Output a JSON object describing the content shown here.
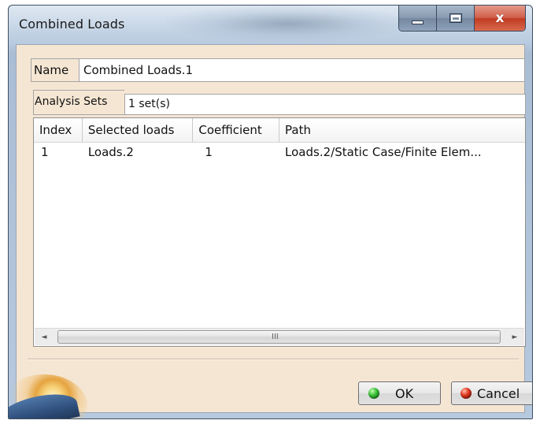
{
  "window": {
    "title": "Combined Loads",
    "controls": {
      "minimize_icon": "minimize-icon",
      "maximize_icon": "maximize-icon",
      "close_icon": "close-icon",
      "close_glyph": "x"
    }
  },
  "form": {
    "name_label": "Name",
    "name_value": "Combined Loads.1",
    "analysis_sets_label": "Analysis Sets",
    "analysis_sets_value": "1 set(s)"
  },
  "table": {
    "columns": [
      "Index",
      "Selected loads",
      "Coefficient",
      "Path"
    ],
    "rows": [
      {
        "index": "1",
        "selected_loads": "Loads.2",
        "coefficient": "1",
        "path": "Loads.2/Static Case/Finite Elem..."
      }
    ]
  },
  "scrollbar": {
    "left_arrow": "◄",
    "right_arrow": "►",
    "grip": "III"
  },
  "buttons": {
    "ok_label": "OK",
    "cancel_label": "Cancel"
  },
  "colors": {
    "panel_background": "#f5e6d3",
    "ok_icon": "#2fb52f",
    "cancel_icon": "#d9301a"
  }
}
